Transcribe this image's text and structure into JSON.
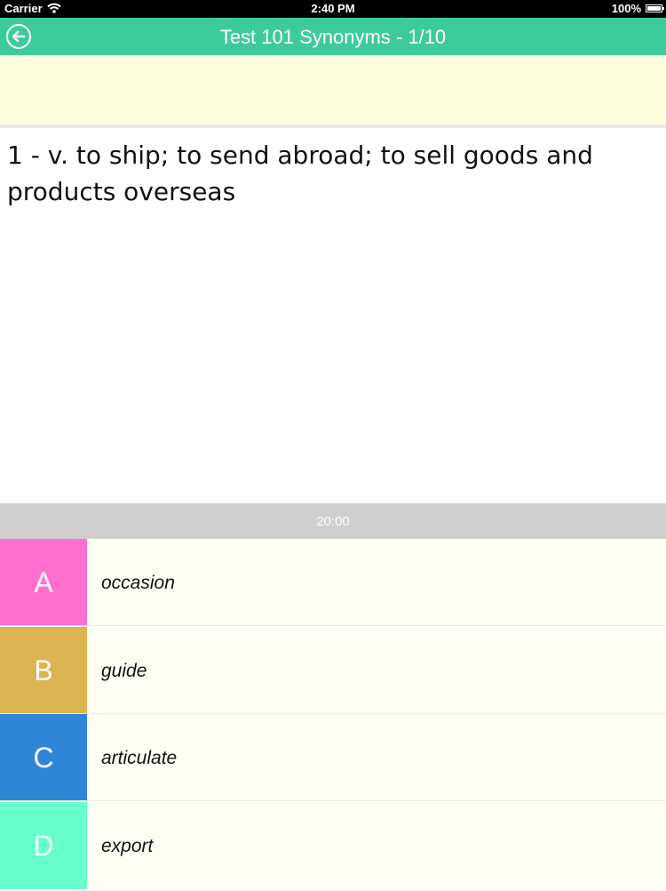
{
  "status_bar": {
    "carrier": "Carrier",
    "time": "2:40 PM",
    "battery": "100%"
  },
  "nav": {
    "title": "Test 101  Synonyms - 1/10",
    "back_icon": "arrow-left-circle-icon",
    "color": "#3ecb9b"
  },
  "question": {
    "text": "1 - v. to ship; to send abroad; to sell goods and products overseas"
  },
  "timer": {
    "value": "20:00"
  },
  "answers": [
    {
      "letter": "A",
      "label": "occasion",
      "color": "#ff6fd0"
    },
    {
      "letter": "B",
      "label": "guide",
      "color": "#dab552"
    },
    {
      "letter": "C",
      "label": "articulate",
      "color": "#2f86d8"
    },
    {
      "letter": "D",
      "label": "export",
      "color": "#66ffcc"
    }
  ]
}
